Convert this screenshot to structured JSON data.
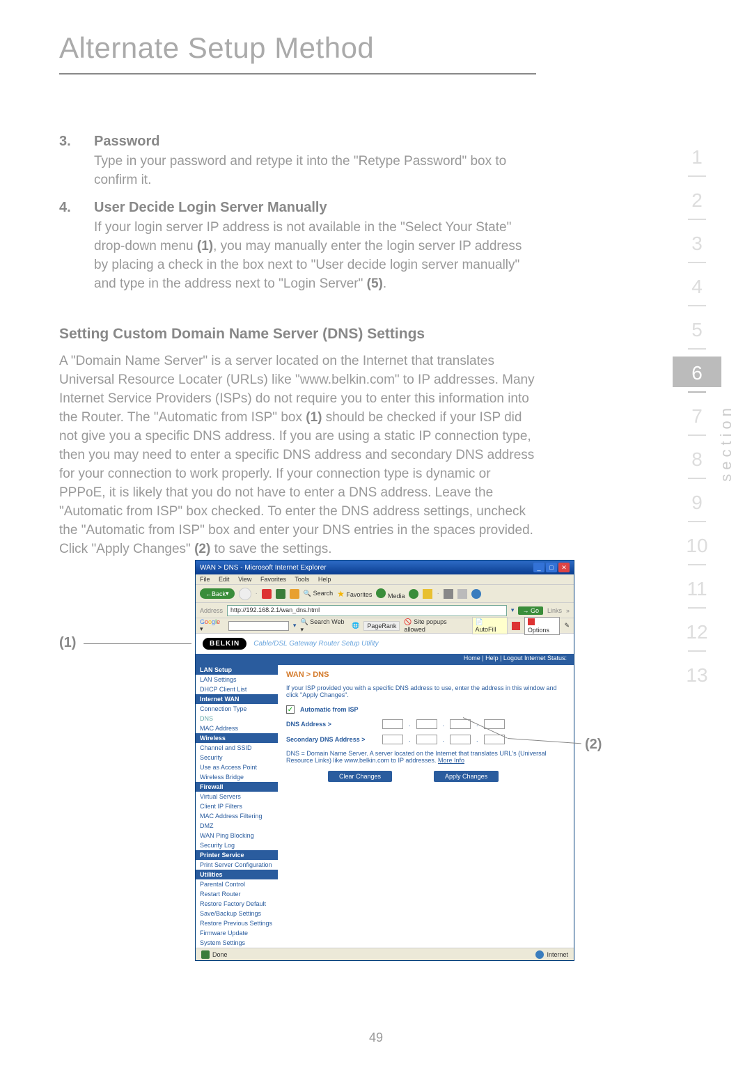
{
  "page": {
    "title": "Alternate Setup Method",
    "number": "49"
  },
  "items": [
    {
      "num": "3.",
      "heading": "Password",
      "text": "Type in your password and retype it into the \"Retype Password\" box to confirm it."
    },
    {
      "num": "4.",
      "heading": "User Decide Login Server Manually",
      "text_parts": [
        "If your login server IP address is not available in the \"Select Your State\" drop-down menu ",
        "(1)",
        ", you may manually enter the login server IP address by placing a check in the box next to \"User decide login server manually\" and type in the address next to \"Login Server\" ",
        "(5)",
        "."
      ]
    }
  ],
  "section": {
    "heading": "Setting Custom Domain Name Server (DNS) Settings",
    "para_parts": [
      "A \"Domain Name Server\" is a server located on the Internet that translates Universal Resource Locater (URLs) like \"www.belkin.com\" to IP addresses. Many Internet Service Providers (ISPs) do not require you to enter this information into the Router. The \"Automatic from ISP\" box ",
      "(1)",
      " should be checked if your ISP did not give you a specific DNS address. If you are using a static IP connection type, then you may need to enter a specific DNS address and secondary DNS address for your connection to work properly. If your connection type is dynamic or PPPoE, it is likely that you do not have to enter a DNS address. Leave the \"Automatic from ISP\" box checked. To enter the DNS address settings, uncheck the \"Automatic from ISP\" box and enter your DNS entries in the spaces provided. Click \"Apply Changes\" ",
      "(2)",
      " to save the settings."
    ]
  },
  "callouts": {
    "one": "(1)",
    "two": "(2)"
  },
  "ie": {
    "title": "WAN > DNS - Microsoft Internet Explorer",
    "menus": [
      "File",
      "Edit",
      "View",
      "Favorites",
      "Tools",
      "Help"
    ],
    "back": "Back",
    "search": "Search",
    "favorites": "Favorites",
    "media": "Media",
    "address_label": "Address",
    "address_value": "http://192.168.2.1/wan_dns.html",
    "go": "Go",
    "links": "Links",
    "google": "Google",
    "google_search": "Search Web",
    "google_pagerank": "PageRank",
    "google_popups": "Site popups allowed",
    "google_autofill": "AutoFill",
    "google_options": "Options",
    "status_done": "Done",
    "status_internet": "Internet"
  },
  "router": {
    "logo": "BELKIN",
    "subtitle": "Cable/DSL Gateway Router Setup Utility",
    "topbar": "Home | Help | Logout    Internet Status:",
    "nav": {
      "lan_setup": "LAN Setup",
      "lan_settings": "LAN Settings",
      "dhcp_client": "DHCP Client List",
      "internet_wan": "Internet WAN",
      "connection_type": "Connection Type",
      "dns": "DNS",
      "mac_address": "MAC Address",
      "wireless": "Wireless",
      "channel_ssid": "Channel and SSID",
      "security": "Security",
      "use_ap": "Use as Access Point",
      "wireless_bridge": "Wireless Bridge",
      "firewall": "Firewall",
      "virtual_servers": "Virtual Servers",
      "client_ip": "Client IP Filters",
      "mac_filtering": "MAC Address Filtering",
      "dmz": "DMZ",
      "wan_ping": "WAN Ping Blocking",
      "security_log": "Security Log",
      "printer_service": "Printer Service",
      "print_server": "Print Server Configuration",
      "utilities": "Utilities",
      "parental": "Parental Control",
      "restart": "Restart Router",
      "restore_factory": "Restore Factory Default",
      "save_backup": "Save/Backup Settings",
      "restore_prev": "Restore Previous Settings",
      "firmware": "Firmware Update",
      "system": "System Settings"
    },
    "breadcrumb": "WAN > DNS",
    "intro": "If your ISP provided you with a specific DNS address to use, enter the address in this window and click \"Apply Changes\".",
    "auto_isp": "Automatic from ISP",
    "dns_addr": "DNS Address >",
    "sec_dns": "Secondary DNS Address >",
    "note": "DNS = Domain Name Server. A server located on the Internet that translates URL's (Universal Resource Links) like www.belkin.com to IP addresses.",
    "more_info": "More Info",
    "clear": "Clear Changes",
    "apply": "Apply Changes"
  },
  "tabs": {
    "label": "section",
    "nums": [
      "1",
      "2",
      "3",
      "4",
      "5",
      "6",
      "7",
      "8",
      "9",
      "10",
      "11",
      "12",
      "13"
    ],
    "active": "6"
  }
}
